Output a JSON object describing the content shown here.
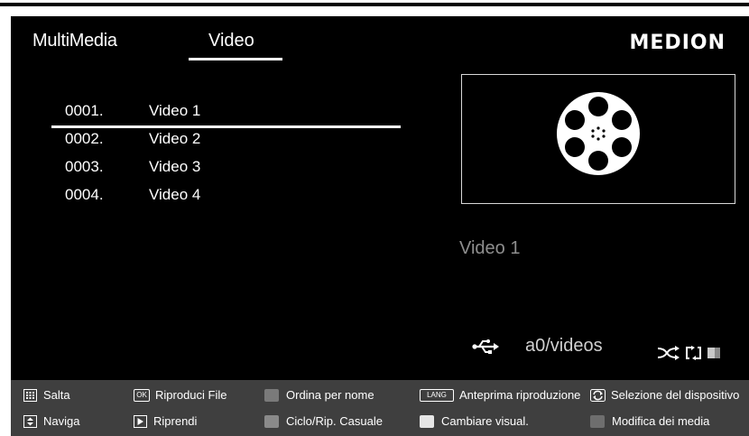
{
  "header": {
    "app_title": "MultiMedia",
    "active_tab": "Video",
    "brand": "MEDION"
  },
  "file_list": [
    {
      "number": "0001.",
      "name": "Video 1",
      "selected": true
    },
    {
      "number": "0002.",
      "name": "Video 2",
      "selected": false
    },
    {
      "number": "0003.",
      "name": "Video 3",
      "selected": false
    },
    {
      "number": "0004.",
      "name": "Video 4",
      "selected": false
    }
  ],
  "preview": {
    "icon": "film-reel-icon",
    "title": "Video 1"
  },
  "status": {
    "source_icon": "usb-icon",
    "path": "a0/videos",
    "mode_icons": [
      "shuffle-icon",
      "repeat-icon",
      "block-icon"
    ]
  },
  "footer": {
    "row1": {
      "jump": "Salta",
      "play_file": "Riproduci File",
      "sort_by_name": "Ordina per nome",
      "preview_playback": "Anteprima riproduzione",
      "device_selection": "Selezione del dispositivo"
    },
    "row2": {
      "navigate": "Naviga",
      "resume": "Riprendi",
      "loop_shuffle": "Ciclo/Rip. Casuale",
      "change_view": "Cambiare visual.",
      "edit_media": "Modifica dei media"
    },
    "keys": {
      "ok": "OK",
      "lang": "LANG"
    }
  },
  "colors": {
    "background": "#000000",
    "footer": "#3f3f3f",
    "red_key": "#7a7a7a",
    "green_key": "#8a8a8a",
    "yellow_key": "#e6e6e6",
    "blue_key": "#6e6e6e"
  }
}
